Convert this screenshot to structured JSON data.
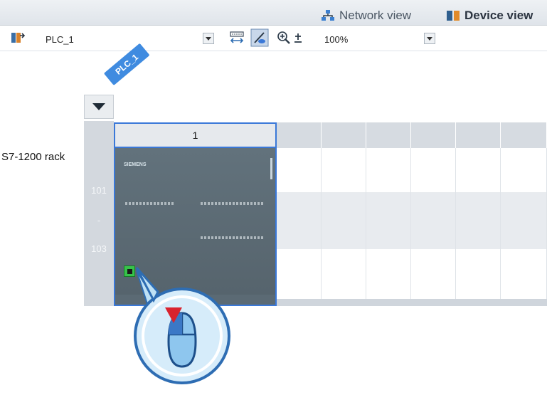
{
  "tabs": {
    "network_label": "Network view",
    "device_label": "Device view"
  },
  "toolbar": {
    "device_select": "PLC_1",
    "zoom_select": "100%"
  },
  "canvas": {
    "plc_tag": "PLC_1",
    "rack_label": "S7-1200 rack",
    "slot_header": "1",
    "row_numbers": [
      "101",
      "-",
      "103"
    ],
    "module_brand": "SIEMENS"
  },
  "colors": {
    "accent": "#3a78d8",
    "tag": "#3f8be0",
    "port": "#37c24a",
    "cursor_arrow": "#d9232e"
  }
}
